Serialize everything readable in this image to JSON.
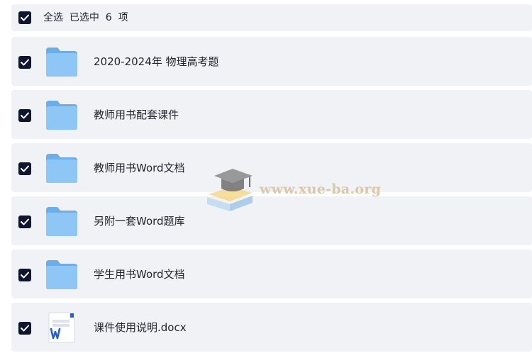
{
  "header": {
    "select_all_label": "全选  已选中  6  项",
    "checked": true
  },
  "colors": {
    "row_background": "#f1f2f5",
    "checkbox": "#0f1530",
    "folder": "#6fb3ef",
    "word_blue": "#1f5fd6"
  },
  "items": [
    {
      "name": "2020-2024年 物理高考题",
      "icon": "folder-icon",
      "checked": true
    },
    {
      "name": "教师用书配套课件",
      "icon": "folder-icon",
      "checked": true
    },
    {
      "name": "教师用书Word文档",
      "icon": "folder-icon",
      "checked": true
    },
    {
      "name": "另附一套Word题库",
      "icon": "folder-icon",
      "checked": true
    },
    {
      "name": "学生用书Word文档",
      "icon": "folder-icon",
      "checked": true
    },
    {
      "name": "课件使用说明.docx",
      "icon": "word-doc-icon",
      "checked": true
    }
  ],
  "watermark": {
    "text": "www.xue-ba.org",
    "icon": "graduation-cap-icon"
  }
}
